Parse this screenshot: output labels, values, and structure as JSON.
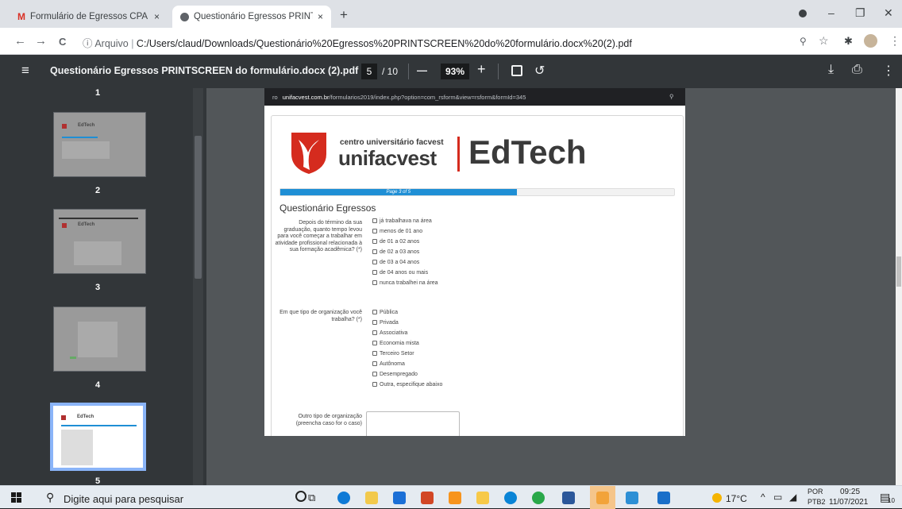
{
  "tabs": [
    {
      "title": "Formulário de Egressos CPA unifa",
      "close": "×"
    },
    {
      "title": "Questionário Egressos PRINTSCR",
      "close": "×"
    }
  ],
  "new_tab": "+",
  "window_controls": {
    "minimize": "–",
    "restore": "❐",
    "close": "✕"
  },
  "address": {
    "back": "←",
    "forward": "→",
    "reload": "C",
    "info": "ⓘ",
    "scheme": "Arquivo",
    "url": "C:/Users/claud/Downloads/Questionário%20Egressos%20PRINTSCREEN%20do%20formulário.docx%20(2).pdf"
  },
  "pdf_toolbar": {
    "menu": "≡",
    "title": "Questionário Egressos PRINTSCREEN do formulário.docx (2).pdf",
    "page_current": "5",
    "page_total": "/ 10",
    "zoom_out": "—",
    "zoom": "93%",
    "zoom_in": "+",
    "download": "⤓",
    "print": "⎙",
    "more": "⋮"
  },
  "thumbnails": [
    {
      "label": "2",
      "brand": "EdTech"
    },
    {
      "label": "3",
      "brand": "EdTech"
    },
    {
      "label": "4",
      "brand": ""
    },
    {
      "label": "5",
      "brand": "EdTech"
    }
  ],
  "top_partial_label": "1",
  "page": {
    "browser_bar": {
      "prefix": "ro",
      "domain": "unifacvest.com.br",
      "path": "/formularios2019/index.php?option=com_rsform&view=rsform&formId=345"
    },
    "logo": {
      "line1": "centro universitário facvest",
      "line2": "unifacvest",
      "brand": "EdTech"
    },
    "progress": {
      "label": "Page 3 of 5",
      "percent": 60
    },
    "heading": "Questionário Egressos",
    "q1": {
      "label": "Depois do término da sua graduação, quanto tempo levou para você começar a trabalhar em atividade profissional relacionada à sua formação acadêmica? (*)",
      "options": [
        "já trabalhava na área",
        "menos de 01 ano",
        "de 01 a 02 anos",
        "de 02 a 03 anos",
        "de 03 a 04 anos",
        "de 04 anos ou mais",
        "nunca trabalhei na área"
      ]
    },
    "q2": {
      "label": "Em que tipo de organização você trabalha? (*)",
      "options": [
        "Pública",
        "Privada",
        "Associativa",
        "Economia mista",
        "Terceiro Setor",
        "Autônoma",
        "Desempregado",
        "Outra, especifique abaixo"
      ]
    },
    "q3": {
      "label": "Outro tipo de organização (preencha caso for o caso)"
    }
  },
  "taskbar": {
    "search_placeholder": "Digite aqui para pesquisar",
    "temperature": "17°C",
    "lang1": "POR",
    "lang2": "PTB2",
    "time": "09:25",
    "date": "11/07/2021",
    "notifications": "10"
  },
  "colors": {
    "progress": "#1f8fd5",
    "logo_red": "#d52b1e",
    "logo_text": "#3a3a3a"
  }
}
